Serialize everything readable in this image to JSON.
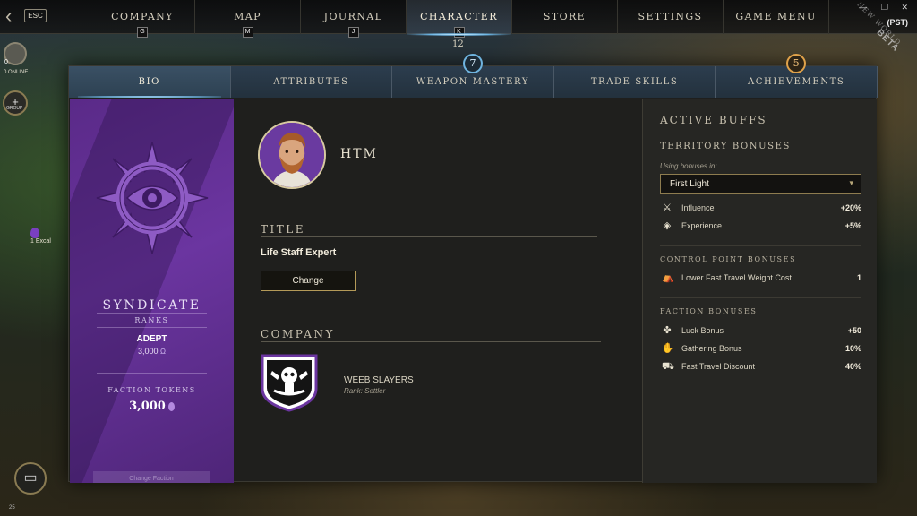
{
  "topbar": {
    "esc_label": "ESC",
    "nav": [
      {
        "label": "COMPANY",
        "key": "G"
      },
      {
        "label": "MAP",
        "key": "M"
      },
      {
        "label": "JOURNAL",
        "key": "J"
      },
      {
        "label": "CHARACTER",
        "key": "K"
      },
      {
        "label": "STORE",
        "key": ""
      },
      {
        "label": "SETTINGS",
        "key": ""
      },
      {
        "label": "GAME MENU",
        "key": ""
      }
    ],
    "character_level": "12",
    "timezone": "(PST)",
    "beta_label": "BETA",
    "watermark": "NEW WORLD"
  },
  "sidebar": {
    "online_count": "0",
    "online_label": "0 ONLINE",
    "group_label": "GROUP",
    "nearby_player": "1 Excal",
    "bottom_number": "25"
  },
  "subtabs": [
    {
      "label": "BIO",
      "badge": ""
    },
    {
      "label": "ATTRIBUTES",
      "badge": ""
    },
    {
      "label": "WEAPON MASTERY",
      "badge": "7"
    },
    {
      "label": "TRADE SKILLS",
      "badge": ""
    },
    {
      "label": "ACHIEVEMENTS",
      "badge": "5"
    }
  ],
  "faction": {
    "name": "SYNDICATE",
    "ranks_label": "RANKS",
    "rank": "ADEPT",
    "reputation": "3,000",
    "tokens_label": "FACTION TOKENS",
    "tokens_value": "3,000",
    "change_button": "Change Faction",
    "color": "#6b35a0"
  },
  "bio": {
    "character_name": "HTM",
    "title_heading": "TITLE",
    "title_value": "Life Staff Expert",
    "change_button": "Change",
    "company_heading": "COMPANY",
    "company_name": "WEEB SLAYERS",
    "company_rank": "Rank: Settler"
  },
  "buffs": {
    "heading": "ACTIVE BUFFS",
    "territory_heading": "TERRITORY BONUSES",
    "using_label": "Using bonuses in:",
    "territory_selected": "First Light",
    "territory_bonuses": [
      {
        "icon": "crossed-swords-icon",
        "label": "Influence",
        "value": "+20%"
      },
      {
        "icon": "xp-icon",
        "label": "Experience",
        "value": "+5%"
      }
    ],
    "control_heading": "CONTROL POINT BONUSES",
    "control_bonuses": [
      {
        "icon": "fast-travel-icon",
        "label": "Lower Fast Travel Weight Cost",
        "value": "1"
      }
    ],
    "faction_heading": "FACTION BONUSES",
    "faction_bonuses": [
      {
        "icon": "clover-icon",
        "label": "Luck Bonus",
        "value": "+50"
      },
      {
        "icon": "gathering-icon",
        "label": "Gathering Bonus",
        "value": "10%"
      },
      {
        "icon": "travel-discount-icon",
        "label": "Fast Travel Discount",
        "value": "40%"
      }
    ]
  }
}
